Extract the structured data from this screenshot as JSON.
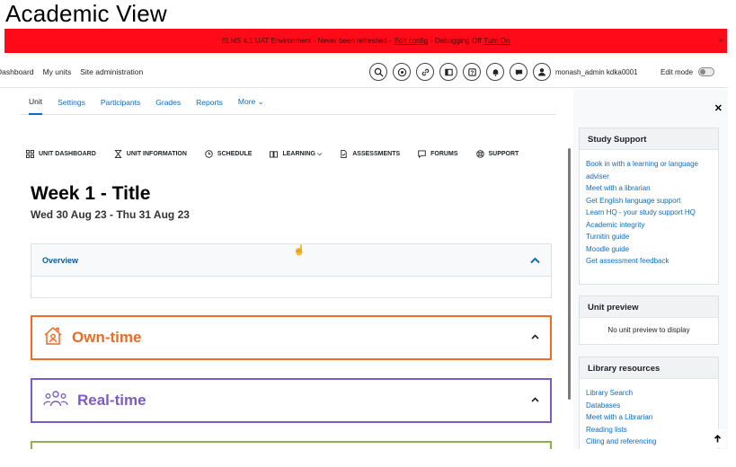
{
  "page_heading": "Academic View",
  "env_bar": {
    "text": "ELMS 4.1 UAT Environment - Never been refreshed -",
    "edit_config": "Edit config",
    "debug_text": "- Debugging Off",
    "turn_on": "Turn On",
    "close": "×"
  },
  "topnav": {
    "links": [
      "Dashboard",
      "My units",
      "Site administration"
    ],
    "user_name": "monash_admin kdka0001",
    "edit_mode": "Edit mode",
    "icons": [
      "search-icon",
      "accessibility-icon",
      "link-icon",
      "book-icon",
      "help-icon",
      "bell-icon",
      "chat-icon"
    ]
  },
  "tabs": [
    "Unit",
    "Settings",
    "Participants",
    "Grades",
    "Reports",
    "More ⌄"
  ],
  "unit_nav": [
    "UNIT DASHBOARD",
    "UNIT INFORMATION",
    "SCHEDULE",
    "LEARNING ⌵",
    "ASSESSMENTS",
    "FORUMS",
    "SUPPORT"
  ],
  "week": {
    "title": "Week 1 - Title",
    "dates": "Wed 30 Aug 23 - Thu 31 Aug 23"
  },
  "overview": {
    "label": "Overview"
  },
  "sections": {
    "own_time": "Own-time",
    "real_time": "Real-time",
    "own_color": "#f06a24",
    "real_color": "#7c5cc4",
    "next_color": "#8cb04b"
  },
  "drawer": {
    "study_support": {
      "title": "Study Support",
      "links": [
        "Book in with a learning or language adviser",
        "Meet with a librarian",
        "Get English language support",
        "Learn HQ - your study support HQ",
        "Academic integrity",
        "Turnitin guide",
        "Moodle guide",
        "Get assessment feedback"
      ]
    },
    "unit_preview": {
      "title": "Unit preview",
      "text": "No unit preview to display"
    },
    "library": {
      "title": "Library resources",
      "links": [
        "Library Search",
        "Databases",
        "Meet with a Librarian",
        "Reading lists",
        "Citing and referencing"
      ]
    }
  }
}
